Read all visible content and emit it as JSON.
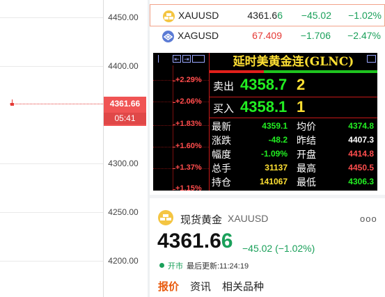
{
  "chart": {
    "y_labels": [
      "4450.00",
      "4400.00",
      "4300.00",
      "4250.00",
      "4200.00"
    ],
    "crosshair_price": "4361.66",
    "crosshair_time": "05:41"
  },
  "quotes": [
    {
      "name": "XAUUSD",
      "price_main": "4361.6",
      "price_last": "6",
      "change": "−45.02",
      "percent": "−1.02%",
      "price_color": "#222222",
      "icon_color": "#f4c542"
    },
    {
      "name": "XAGUSD",
      "price_main": "67.409",
      "price_last": "",
      "change": "−1.706",
      "percent": "−2.47%",
      "price_color": "#e53935",
      "icon_color": "#5b7bd5"
    }
  ],
  "terminal": {
    "title": "延时美黄金连(GLNC)",
    "left_pcts": [
      "+2.29%",
      "+2.06%",
      "+1.83%",
      "+1.60%",
      "+1.37%",
      "+1.15%"
    ],
    "sell_label": "卖出",
    "sell_price": "4358.7",
    "sell_vol": "2",
    "buy_label": "买入",
    "buy_price": "4358.1",
    "buy_vol": "1",
    "stats": [
      {
        "l1": "最新",
        "v1": "4359.1",
        "c1": "#22ee22",
        "l2": "均价",
        "v2": "4374.8",
        "c2": "#22ee22"
      },
      {
        "l1": "涨跌",
        "v1": "-48.2",
        "c1": "#22ee22",
        "l2": "昨结",
        "v2": "4407.3",
        "c2": "#ffffff"
      },
      {
        "l1": "幅度",
        "v1": "-1.09%",
        "c1": "#22ee22",
        "l2": "开盘",
        "v2": "4414.8",
        "c2": "#ff4d4d"
      },
      {
        "l1": "总手",
        "v1": "31137",
        "c1": "#ffe033",
        "l2": "最高",
        "v2": "4450.5",
        "c2": "#ff4d4d"
      },
      {
        "l1": "持仓",
        "v1": "141067",
        "c1": "#ffe033",
        "l2": "最低",
        "v2": "4306.3",
        "c2": "#22ee22"
      }
    ]
  },
  "card": {
    "name": "现货黄金",
    "code": "XAUUSD",
    "more": "ooo",
    "price_main": "4361.6",
    "price_last": "6",
    "change": "−45.02 (−1.02%)",
    "status": "开市",
    "last_update": "最后更新:11:24:19",
    "tabs": [
      "报价",
      "资讯",
      "相关品种"
    ]
  },
  "colors": {
    "up": "#e53935",
    "down": "#1aa05a",
    "accent": "#e8590c"
  }
}
